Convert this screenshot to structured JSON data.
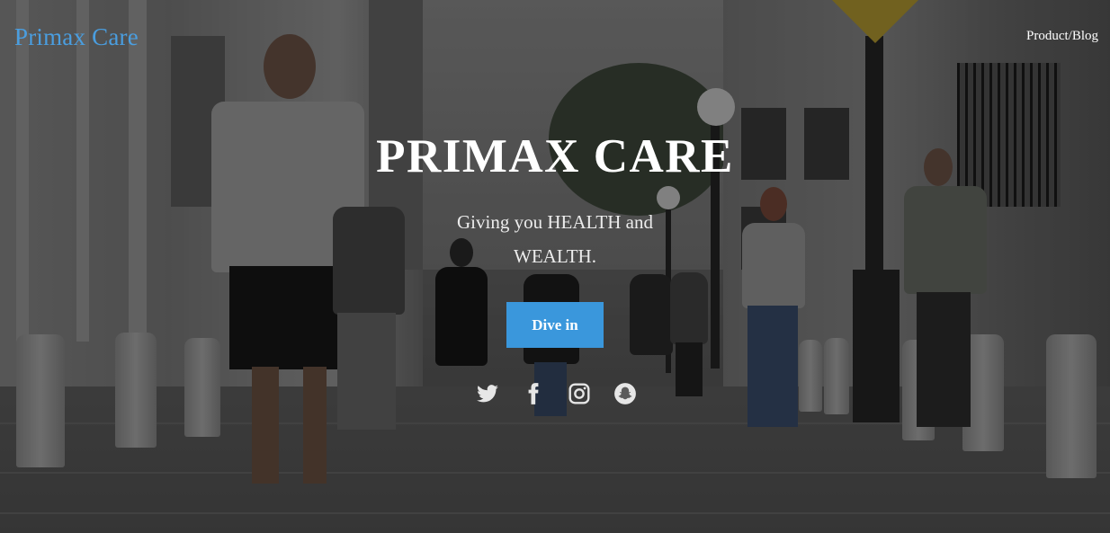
{
  "header": {
    "brand": "Primax Care",
    "nav_link": "Product/Blog"
  },
  "hero": {
    "title": "PRIMAX CARE",
    "subtitle": "Giving you HEALTH and WEALTH.",
    "cta_label": "Dive in"
  },
  "social_icons": [
    "twitter-icon",
    "facebook-icon",
    "instagram-icon",
    "snapchat-icon"
  ],
  "colors": {
    "brand": "#4a9ee0",
    "cta_background": "#3a97dc",
    "text": "#ffffff"
  }
}
